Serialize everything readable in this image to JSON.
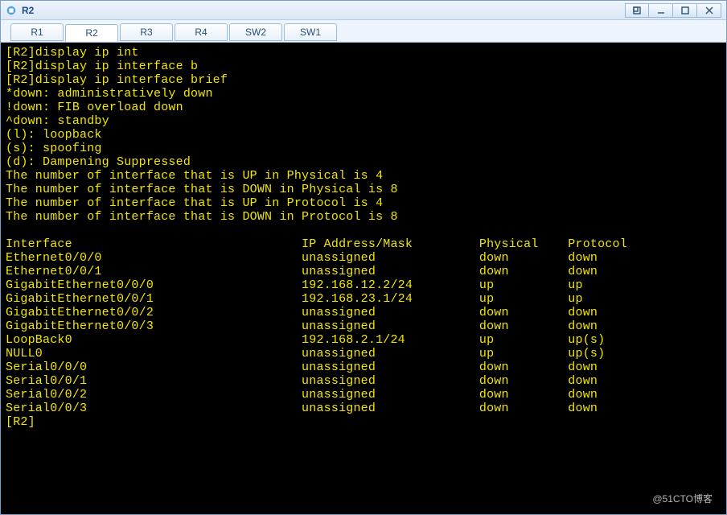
{
  "window": {
    "title": "R2"
  },
  "tabs": [
    {
      "label": "R1",
      "active": false
    },
    {
      "label": "R2",
      "active": true
    },
    {
      "label": "R3",
      "active": false
    },
    {
      "label": "R4",
      "active": false
    },
    {
      "label": "SW2",
      "active": false
    },
    {
      "label": "SW1",
      "active": false
    }
  ],
  "terminal": {
    "prompt": "[R2]",
    "commands": [
      "[R2]display ip int",
      "[R2]display ip interface b",
      "[R2]display ip interface brief"
    ],
    "legend": [
      "*down: administratively down",
      "!down: FIB overload down",
      "^down: standby",
      "(l): loopback",
      "(s): spoofing",
      "(d): Dampening Suppressed"
    ],
    "stats": [
      "The number of interface that is UP in Physical is 4",
      "The number of interface that is DOWN in Physical is 8",
      "The number of interface that is UP in Protocol is 4",
      "The number of interface that is DOWN in Protocol is 8"
    ],
    "header": {
      "interface": "Interface",
      "ip": "IP Address/Mask",
      "physical": "Physical",
      "protocol": "Protocol"
    },
    "rows": [
      {
        "interface": "Ethernet0/0/0",
        "ip": "unassigned",
        "physical": "down",
        "protocol": "down"
      },
      {
        "interface": "Ethernet0/0/1",
        "ip": "unassigned",
        "physical": "down",
        "protocol": "down"
      },
      {
        "interface": "GigabitEthernet0/0/0",
        "ip": "192.168.12.2/24",
        "physical": "up",
        "protocol": "up"
      },
      {
        "interface": "GigabitEthernet0/0/1",
        "ip": "192.168.23.1/24",
        "physical": "up",
        "protocol": "up"
      },
      {
        "interface": "GigabitEthernet0/0/2",
        "ip": "unassigned",
        "physical": "down",
        "protocol": "down"
      },
      {
        "interface": "GigabitEthernet0/0/3",
        "ip": "unassigned",
        "physical": "down",
        "protocol": "down"
      },
      {
        "interface": "LoopBack0",
        "ip": "192.168.2.1/24",
        "physical": "up",
        "protocol": "up(s)"
      },
      {
        "interface": "NULL0",
        "ip": "unassigned",
        "physical": "up",
        "protocol": "up(s)"
      },
      {
        "interface": "Serial0/0/0",
        "ip": "unassigned",
        "physical": "down",
        "protocol": "down"
      },
      {
        "interface": "Serial0/0/1",
        "ip": "unassigned",
        "physical": "down",
        "protocol": "down"
      },
      {
        "interface": "Serial0/0/2",
        "ip": "unassigned",
        "physical": "down",
        "protocol": "down"
      },
      {
        "interface": "Serial0/0/3",
        "ip": "unassigned",
        "physical": "down",
        "protocol": "down"
      }
    ],
    "final_prompt": "[R2]"
  },
  "watermark": "@51CTO博客"
}
